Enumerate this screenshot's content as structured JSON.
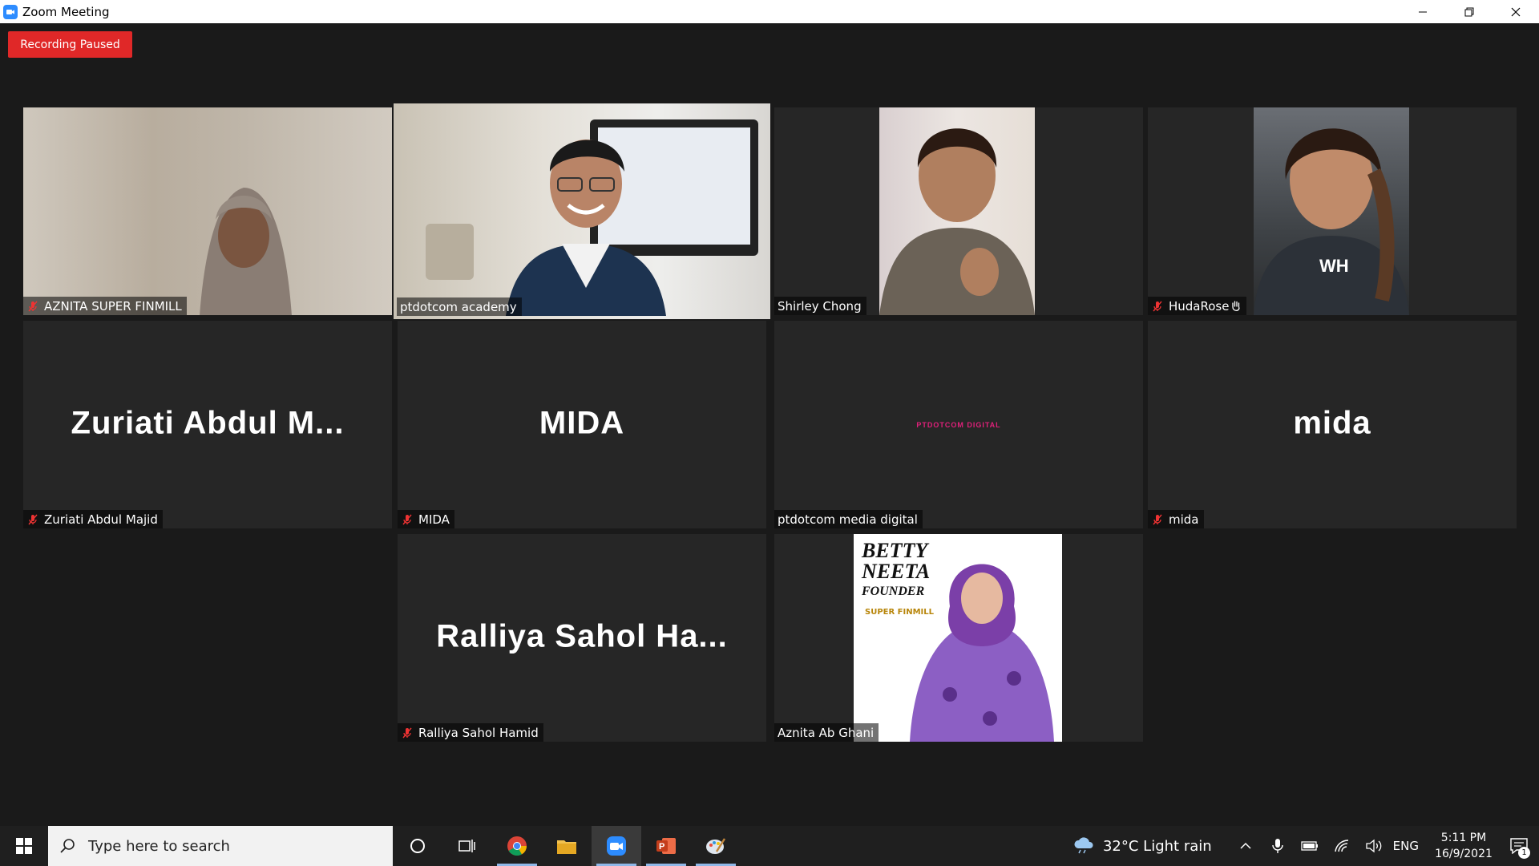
{
  "window": {
    "title": "Zoom Meeting"
  },
  "recording_badge": "Recording Paused",
  "participants": [
    {
      "name": "AZNITA SUPER  FINMILL",
      "muted": true,
      "video": true
    },
    {
      "name": "ptdotcom academy",
      "muted": false,
      "video": true,
      "active_speaker": true
    },
    {
      "name": "Shirley Chong",
      "muted": false,
      "video": true
    },
    {
      "name": "HudaRose",
      "muted": true,
      "video": true,
      "raised_hand": true
    },
    {
      "name": "Zuriati Abdul Majid",
      "display": "Zuriati  Abdul  M...",
      "muted": true,
      "video": false
    },
    {
      "name": "MIDA",
      "display": "MIDA",
      "muted": true,
      "video": false
    },
    {
      "name": "ptdotcom media digital",
      "logo": "PTDOTCOM DIGITAL",
      "muted": false,
      "video": false
    },
    {
      "name": "mida",
      "display": "mida",
      "muted": true,
      "video": false
    },
    {
      "name": "Ralliya Sahol Hamid",
      "display": "Ralliya  Sahol  Ha...",
      "muted": true,
      "video": false
    },
    {
      "name": "Aznita Ab Ghani",
      "muted": false,
      "video": true,
      "poster": {
        "line1": "BETTY",
        "line2": "NEETA",
        "line3": "FOUNDER",
        "brand": "SUPER FINMILL"
      }
    }
  ],
  "taskbar": {
    "search_placeholder": "Type here to search",
    "weather": "32°C  Light rain",
    "language": "ENG",
    "time": "5:11 PM",
    "date": "16/9/2021",
    "notification_count": "1"
  },
  "colors": {
    "recording_red": "#e02828",
    "active_speaker_border": "#f3f37a",
    "tile_bg": "#262626"
  }
}
